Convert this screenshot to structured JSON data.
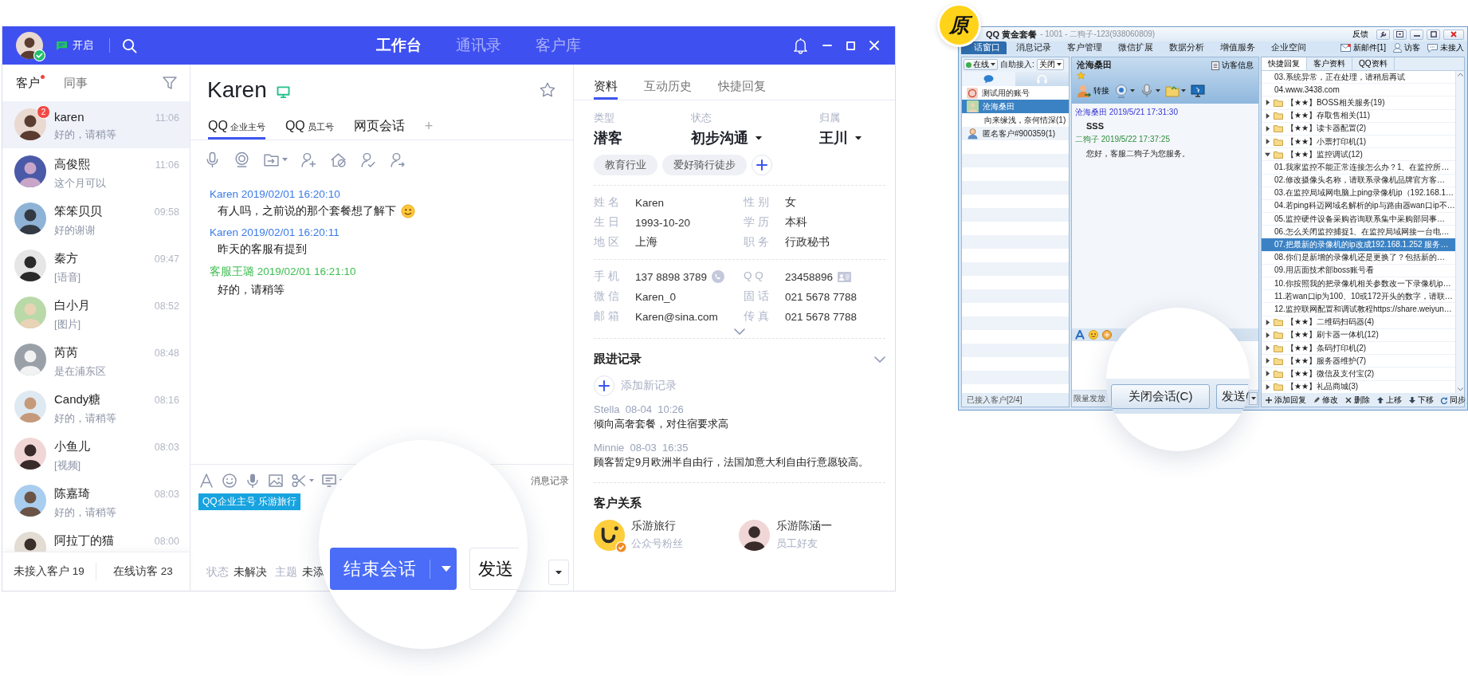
{
  "main": {
    "header": {
      "status": "开启",
      "nav": [
        {
          "label": "工作台",
          "selected": true
        },
        {
          "label": "通讯录",
          "selected": false
        },
        {
          "label": "客户库",
          "selected": false
        }
      ]
    },
    "contacts": {
      "tabs": [
        {
          "label": "客户",
          "selected": true,
          "unread_dot": true
        },
        {
          "label": "同事",
          "selected": false,
          "unread_dot": false
        }
      ],
      "items": [
        {
          "name": "karen",
          "preview": "好的，请稍等",
          "time": "11:06",
          "selected": true,
          "badge": "2"
        },
        {
          "name": "高俊熙",
          "preview": "这个月可以",
          "time": "11:06",
          "selected": false
        },
        {
          "name": "笨笨贝贝",
          "preview": "好的谢谢",
          "time": "09:58",
          "selected": false
        },
        {
          "name": "秦方",
          "preview": "[语音]",
          "time": "09:47",
          "selected": false
        },
        {
          "name": "白小月",
          "preview": "[图片]",
          "time": "08:52",
          "selected": false
        },
        {
          "name": "芮芮",
          "preview": "是在浦东区",
          "time": "08:48",
          "selected": false
        },
        {
          "name": "Candy糖",
          "preview": "好的，请稍等",
          "time": "08:16",
          "selected": false
        },
        {
          "name": "小鱼儿",
          "preview": "[视频]",
          "time": "08:03",
          "selected": false
        },
        {
          "name": "陈嘉琦",
          "preview": "好的，请稍等",
          "time": "08:03",
          "selected": false
        },
        {
          "name": "阿拉丁的猫",
          "time": "08:00",
          "selected": false
        }
      ],
      "footer": [
        "未接入客户 19",
        "在线访客 23"
      ]
    },
    "chat": {
      "title": "Karen",
      "tabs": [
        {
          "label": "QQ",
          "sub": "企业主号",
          "selected": true
        },
        {
          "label": "QQ",
          "sub": "员工号",
          "selected": false
        },
        {
          "label": "网页会话",
          "selected": false
        }
      ],
      "add_tab": "+",
      "messages": [
        {
          "kind": "customer",
          "meta": "Karen 2019/02/01 16:20:10",
          "text": "有人吗，之前说的那个套餐想了解下",
          "emoji": true
        },
        {
          "kind": "customer",
          "meta": "Karen 2019/02/01 16:20:11",
          "text": "昨天的客服有提到",
          "emoji": false
        },
        {
          "kind": "agent",
          "meta": "客服王璐 2019/02/01 16:21:10",
          "text": "好的，请稍等",
          "emoji": false
        }
      ],
      "history_link": "消息记录",
      "account_tag": "QQ企业主号 乐游旅行",
      "status": [
        {
          "label": "状态",
          "value": "未解决"
        },
        {
          "label": "主题",
          "value": "未添"
        }
      ],
      "end_button": "结束会话",
      "send_button": "发送"
    },
    "profile": {
      "tabs": [
        {
          "label": "资料",
          "selected": true
        },
        {
          "label": "互动历史",
          "selected": false
        },
        {
          "label": "快捷回复",
          "selected": false
        }
      ],
      "summary": [
        {
          "label": "类型",
          "value": "潜客",
          "dropdown": false
        },
        {
          "label": "状态",
          "value": "初步沟通",
          "dropdown": true
        },
        {
          "label": "归属",
          "value": "王川",
          "dropdown": true
        }
      ],
      "tags": [
        "教育行业",
        "爱好骑行徒步"
      ],
      "details": [
        [
          {
            "label": "姓 名",
            "value": "Karen"
          },
          {
            "label": "性 别",
            "value": "女"
          },
          {
            "label": "生 日",
            "value": "1993-10-20"
          },
          {
            "label": "学 历",
            "value": "本科"
          },
          {
            "label": "地 区",
            "value": "上海"
          },
          {
            "label": "职 务",
            "value": "行政秘书"
          }
        ],
        [
          {
            "label": "手 机",
            "value": "137 8898 3789",
            "kind": "phone"
          },
          {
            "label": "Q Q",
            "value": "23458896",
            "kind": "card"
          },
          {
            "label": "微 信",
            "value": "Karen_0",
            "kind": "plain"
          },
          {
            "label": "固 话",
            "value": "021 5678 7788",
            "kind": "plain"
          },
          {
            "label": "邮 箱",
            "value": "Karen@sina.com",
            "kind": "plain"
          },
          {
            "label": "传 真",
            "value": "021 5678 7788",
            "kind": "plain"
          }
        ]
      ],
      "follow_up": {
        "title": "跟进记录",
        "add": "添加新记录",
        "records": [
          {
            "meta": "Stella  08-04  10:26",
            "text": "倾向高奢套餐，对住宿要求高"
          },
          {
            "meta": "Minnie  08-03  16:35",
            "text": "顾客暂定9月欧洲半自由行，法国加意大利自由行意愿较高。"
          }
        ]
      },
      "relations": {
        "title": "客户关系",
        "items": [
          {
            "kind": "account",
            "name": "乐游旅行",
            "role": "公众号粉丝"
          },
          {
            "kind": "person",
            "name": "乐游陈涵一",
            "role": "员工好友"
          }
        ]
      }
    }
  },
  "legacy": {
    "badge": "原",
    "title": "QQ 黄金套餐",
    "subtitle": "- 1001 - 二狗子-123(938060809)",
    "feedback": "反馈",
    "tabs": [
      {
        "label": "话窗口",
        "selected": true
      },
      {
        "label": "消息记录",
        "selected": false
      },
      {
        "label": "客户管理",
        "selected": false
      },
      {
        "label": "微信扩展",
        "selected": false
      },
      {
        "label": "数据分析",
        "selected": false
      },
      {
        "label": "增值服务",
        "selected": false
      },
      {
        "label": "企业空间",
        "selected": false
      }
    ],
    "links": [
      {
        "kind": "mail",
        "label": "新邮件[1]"
      },
      {
        "kind": "visitor",
        "label": "访客"
      },
      {
        "kind": "chat",
        "label": "未接入"
      }
    ],
    "presence": "在线",
    "auto_label": "自助接入:",
    "auto_value": "关闭",
    "side_tabs": [
      {
        "kind": "chat",
        "selected": true
      },
      {
        "kind": "headset",
        "selected": false
      }
    ],
    "contacts": [
      {
        "kind": "app",
        "name": "测试用的账号",
        "selected": false
      },
      {
        "kind": "photo",
        "name": "沧海桑田",
        "selected": true
      },
      {
        "kind": "none",
        "name": "向来缘浅，奈何情深(1)",
        "selected": false
      },
      {
        "kind": "guest",
        "name": "匿名客户#900359(1)",
        "selected": false
      }
    ],
    "contacts_footer": "已接入客户[2/4]",
    "chat": {
      "name": "沧海桑田",
      "visitor_info": "访客信息",
      "transfer": "转接",
      "messages": [
        {
          "kind": "customer",
          "meta": "沧海桑田 2019/5/21 17:31:30",
          "text": "SSS"
        },
        {
          "kind": "agent",
          "meta": "二狗子 2019/5/22 17:37:25",
          "text": "您好，客服二狗子为您服务。"
        }
      ],
      "notice": "限量发放",
      "close_button": "关闭会话(C)",
      "send_button": "发送("
    },
    "replies": {
      "tabs": [
        {
          "label": "快捷回复",
          "selected": true
        },
        {
          "label": "客户资料",
          "selected": false
        },
        {
          "label": "QQ资料",
          "selected": false
        }
      ],
      "items": [
        {
          "kind": "reply",
          "text": "03.系统异常，正在处理，请稍后再试",
          "selected": false
        },
        {
          "kind": "reply",
          "text": "04.www.3438.com",
          "selected": false
        },
        {
          "kind": "folder",
          "text": "【★★】BOSS相关服务(19)",
          "expanded": false,
          "selected": false
        },
        {
          "kind": "folder",
          "text": "【★★】存取售相关(11)",
          "expanded": false,
          "selected": false
        },
        {
          "kind": "folder",
          "text": "【★★】读卡器配置(2)",
          "expanded": false,
          "selected": false
        },
        {
          "kind": "folder",
          "text": "【★★】小票打印机(1)",
          "expanded": false,
          "selected": false
        },
        {
          "kind": "folder",
          "text": "【★★】监控调试(12)",
          "expanded": true,
          "selected": false,
          "children": [
            {
              "kind": "reply",
              "text": "01.我家监控不能正常连接怎么办？1、在监控所…",
              "selected": false
            },
            {
              "kind": "reply",
              "text": "02.修改摄像头名称，请联系录像机品牌官方客…",
              "selected": false
            },
            {
              "kind": "reply",
              "text": "03.在监控局域网电脑上ping录像机ip（192.168.1…",
              "selected": false
            },
            {
              "kind": "reply",
              "text": "04.若ping科迈网域名解析的ip与路由器wan口ip不…",
              "selected": false
            },
            {
              "kind": "reply",
              "text": "05.监控硬件设备采购咨询联系集中采购部同事…",
              "selected": false
            },
            {
              "kind": "reply",
              "text": "06.怎么关闭监控捕捉1、在监控局域网接一台电…",
              "selected": false
            },
            {
              "kind": "reply",
              "text": "07.把最新的录像机的ip改成192.168.1.252 服务…",
              "selected": true
            },
            {
              "kind": "reply",
              "text": "08.你们是新增的录像机还是更换了？包括新的…",
              "selected": false
            },
            {
              "kind": "reply",
              "text": "09.用店面技术部boss账号看",
              "selected": false
            },
            {
              "kind": "reply",
              "text": "10.你按照我的把录像机相关参数改一下录像机ip…",
              "selected": false
            },
            {
              "kind": "reply",
              "text": "11.若wan口ip为100、10或172开头的数字，请联…",
              "selected": false
            },
            {
              "kind": "reply",
              "text": "12.监控联网配置和调试教程https://share.weiyun…",
              "selected": false
            }
          ]
        },
        {
          "kind": "folder",
          "text": "【★★】二维码扫码器(4)",
          "expanded": false,
          "selected": false
        },
        {
          "kind": "folder",
          "text": "【★★】刷卡器一体机(12)",
          "expanded": false,
          "selected": false
        },
        {
          "kind": "folder",
          "text": "【★★】条码打印机(2)",
          "expanded": false,
          "selected": false
        },
        {
          "kind": "folder",
          "text": "【★★】服务器维护(7)",
          "expanded": false,
          "selected": false
        },
        {
          "kind": "folder",
          "text": "【★★】微信及支付宝(2)",
          "expanded": false,
          "selected": false
        },
        {
          "kind": "folder",
          "text": "【★★】礼品商城(3)",
          "expanded": false,
          "selected": false
        }
      ],
      "actions": [
        {
          "kind": "add",
          "label": "添加回复"
        },
        {
          "kind": "edit",
          "label": "修改"
        },
        {
          "kind": "delete",
          "label": "删除"
        },
        {
          "kind": "up",
          "label": "上移"
        },
        {
          "kind": "down",
          "label": "下移"
        },
        {
          "kind": "sync",
          "label": "同步"
        }
      ]
    }
  }
}
